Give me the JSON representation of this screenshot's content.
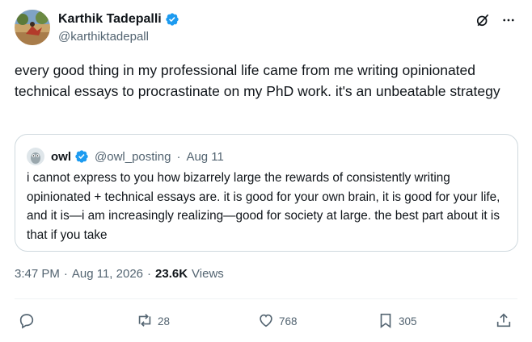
{
  "author": {
    "name": "Karthik Tadepalli",
    "handle": "@karthiktadepall"
  },
  "tweet": {
    "text": "every good thing in my professional life came from me writing opinionated technical essays to procrastinate on my PhD work. it's an unbeatable strategy"
  },
  "quoted": {
    "name": "owl",
    "handle": "@owl_posting",
    "separator": "·",
    "date": "Aug 11",
    "text": "i cannot express to you how bizarrely large the rewards of consistently writing opinionated + technical essays are. it is good for your own brain, it is good for your life, and it is—i am increasingly realizing—good for society at large. the best part about it is that if you take"
  },
  "meta": {
    "time": "3:47 PM",
    "dot1": "·",
    "date": "Aug 11, 2026",
    "dot2": "·",
    "views_count": "23.6K",
    "views_label": "Views"
  },
  "actions": {
    "replies": "",
    "reposts": "28",
    "likes": "768",
    "bookmarks": "305"
  },
  "colors": {
    "verified": "#1d9bf0",
    "text": "#0f1419",
    "secondary": "#536471",
    "border": "#cfd9de"
  },
  "icons": [
    "verified-icon",
    "grok-icon",
    "more-icon",
    "reply-icon",
    "repost-icon",
    "like-icon",
    "bookmark-icon",
    "share-icon"
  ]
}
